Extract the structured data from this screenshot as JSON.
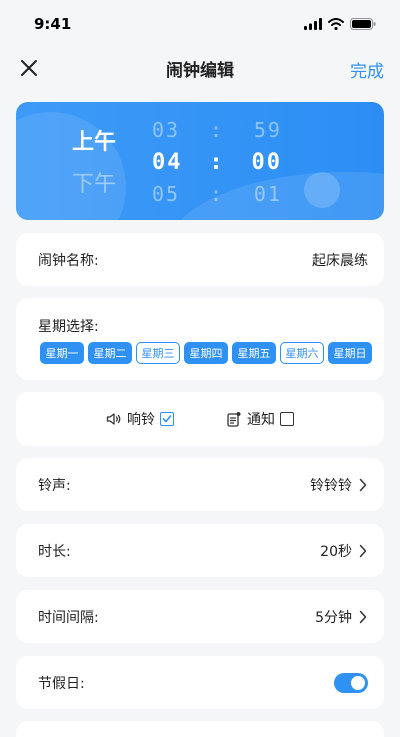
{
  "status": {
    "time": "9:41"
  },
  "nav": {
    "title": "闹钟编辑",
    "done_label": "完成"
  },
  "time_picker": {
    "ampm_selected": "上午",
    "ampm_other": "下午",
    "prev": {
      "hour": "03",
      "minute": "59"
    },
    "current": {
      "hour": "04",
      "minute": "00"
    },
    "next": {
      "hour": "05",
      "minute": "01"
    },
    "separator": ":"
  },
  "name": {
    "label": "闹钟名称:",
    "value": "起床晨练"
  },
  "week": {
    "label": "星期选择:",
    "days": [
      {
        "label": "星期一",
        "selected": true
      },
      {
        "label": "星期二",
        "selected": true
      },
      {
        "label": "星期三",
        "selected": false
      },
      {
        "label": "星期四",
        "selected": true
      },
      {
        "label": "星期五",
        "selected": true
      },
      {
        "label": "星期六",
        "selected": false
      },
      {
        "label": "星期日",
        "selected": true
      }
    ]
  },
  "alerts": {
    "ring": {
      "label": "响铃",
      "checked": true,
      "icon": "speaker-icon"
    },
    "notify": {
      "label": "通知",
      "checked": false,
      "icon": "notification-icon"
    }
  },
  "ringtone": {
    "label": "铃声:",
    "value": "铃铃铃"
  },
  "duration": {
    "label": "时长:",
    "value": "20秒"
  },
  "interval": {
    "label": "时间间隔:",
    "value": "5分钟"
  },
  "holiday": {
    "label": "节假日:",
    "enabled": true
  },
  "colors": {
    "accent": "#2f91f3",
    "background": "#f5f6f8"
  }
}
